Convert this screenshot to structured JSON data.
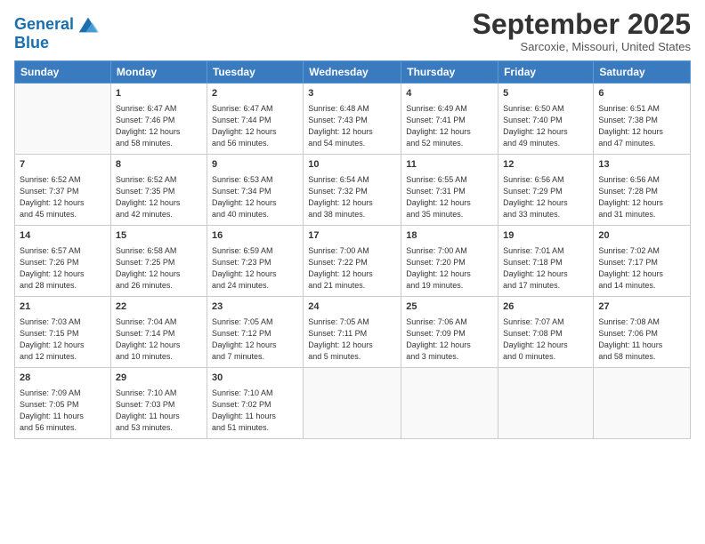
{
  "header": {
    "logo_line1": "General",
    "logo_line2": "Blue",
    "month": "September 2025",
    "location": "Sarcoxie, Missouri, United States"
  },
  "days_of_week": [
    "Sunday",
    "Monday",
    "Tuesday",
    "Wednesday",
    "Thursday",
    "Friday",
    "Saturday"
  ],
  "weeks": [
    [
      {
        "day": "",
        "info": ""
      },
      {
        "day": "1",
        "info": "Sunrise: 6:47 AM\nSunset: 7:46 PM\nDaylight: 12 hours\nand 58 minutes."
      },
      {
        "day": "2",
        "info": "Sunrise: 6:47 AM\nSunset: 7:44 PM\nDaylight: 12 hours\nand 56 minutes."
      },
      {
        "day": "3",
        "info": "Sunrise: 6:48 AM\nSunset: 7:43 PM\nDaylight: 12 hours\nand 54 minutes."
      },
      {
        "day": "4",
        "info": "Sunrise: 6:49 AM\nSunset: 7:41 PM\nDaylight: 12 hours\nand 52 minutes."
      },
      {
        "day": "5",
        "info": "Sunrise: 6:50 AM\nSunset: 7:40 PM\nDaylight: 12 hours\nand 49 minutes."
      },
      {
        "day": "6",
        "info": "Sunrise: 6:51 AM\nSunset: 7:38 PM\nDaylight: 12 hours\nand 47 minutes."
      }
    ],
    [
      {
        "day": "7",
        "info": "Sunrise: 6:52 AM\nSunset: 7:37 PM\nDaylight: 12 hours\nand 45 minutes."
      },
      {
        "day": "8",
        "info": "Sunrise: 6:52 AM\nSunset: 7:35 PM\nDaylight: 12 hours\nand 42 minutes."
      },
      {
        "day": "9",
        "info": "Sunrise: 6:53 AM\nSunset: 7:34 PM\nDaylight: 12 hours\nand 40 minutes."
      },
      {
        "day": "10",
        "info": "Sunrise: 6:54 AM\nSunset: 7:32 PM\nDaylight: 12 hours\nand 38 minutes."
      },
      {
        "day": "11",
        "info": "Sunrise: 6:55 AM\nSunset: 7:31 PM\nDaylight: 12 hours\nand 35 minutes."
      },
      {
        "day": "12",
        "info": "Sunrise: 6:56 AM\nSunset: 7:29 PM\nDaylight: 12 hours\nand 33 minutes."
      },
      {
        "day": "13",
        "info": "Sunrise: 6:56 AM\nSunset: 7:28 PM\nDaylight: 12 hours\nand 31 minutes."
      }
    ],
    [
      {
        "day": "14",
        "info": "Sunrise: 6:57 AM\nSunset: 7:26 PM\nDaylight: 12 hours\nand 28 minutes."
      },
      {
        "day": "15",
        "info": "Sunrise: 6:58 AM\nSunset: 7:25 PM\nDaylight: 12 hours\nand 26 minutes."
      },
      {
        "day": "16",
        "info": "Sunrise: 6:59 AM\nSunset: 7:23 PM\nDaylight: 12 hours\nand 24 minutes."
      },
      {
        "day": "17",
        "info": "Sunrise: 7:00 AM\nSunset: 7:22 PM\nDaylight: 12 hours\nand 21 minutes."
      },
      {
        "day": "18",
        "info": "Sunrise: 7:00 AM\nSunset: 7:20 PM\nDaylight: 12 hours\nand 19 minutes."
      },
      {
        "day": "19",
        "info": "Sunrise: 7:01 AM\nSunset: 7:18 PM\nDaylight: 12 hours\nand 17 minutes."
      },
      {
        "day": "20",
        "info": "Sunrise: 7:02 AM\nSunset: 7:17 PM\nDaylight: 12 hours\nand 14 minutes."
      }
    ],
    [
      {
        "day": "21",
        "info": "Sunrise: 7:03 AM\nSunset: 7:15 PM\nDaylight: 12 hours\nand 12 minutes."
      },
      {
        "day": "22",
        "info": "Sunrise: 7:04 AM\nSunset: 7:14 PM\nDaylight: 12 hours\nand 10 minutes."
      },
      {
        "day": "23",
        "info": "Sunrise: 7:05 AM\nSunset: 7:12 PM\nDaylight: 12 hours\nand 7 minutes."
      },
      {
        "day": "24",
        "info": "Sunrise: 7:05 AM\nSunset: 7:11 PM\nDaylight: 12 hours\nand 5 minutes."
      },
      {
        "day": "25",
        "info": "Sunrise: 7:06 AM\nSunset: 7:09 PM\nDaylight: 12 hours\nand 3 minutes."
      },
      {
        "day": "26",
        "info": "Sunrise: 7:07 AM\nSunset: 7:08 PM\nDaylight: 12 hours\nand 0 minutes."
      },
      {
        "day": "27",
        "info": "Sunrise: 7:08 AM\nSunset: 7:06 PM\nDaylight: 11 hours\nand 58 minutes."
      }
    ],
    [
      {
        "day": "28",
        "info": "Sunrise: 7:09 AM\nSunset: 7:05 PM\nDaylight: 11 hours\nand 56 minutes."
      },
      {
        "day": "29",
        "info": "Sunrise: 7:10 AM\nSunset: 7:03 PM\nDaylight: 11 hours\nand 53 minutes."
      },
      {
        "day": "30",
        "info": "Sunrise: 7:10 AM\nSunset: 7:02 PM\nDaylight: 11 hours\nand 51 minutes."
      },
      {
        "day": "",
        "info": ""
      },
      {
        "day": "",
        "info": ""
      },
      {
        "day": "",
        "info": ""
      },
      {
        "day": "",
        "info": ""
      }
    ]
  ]
}
